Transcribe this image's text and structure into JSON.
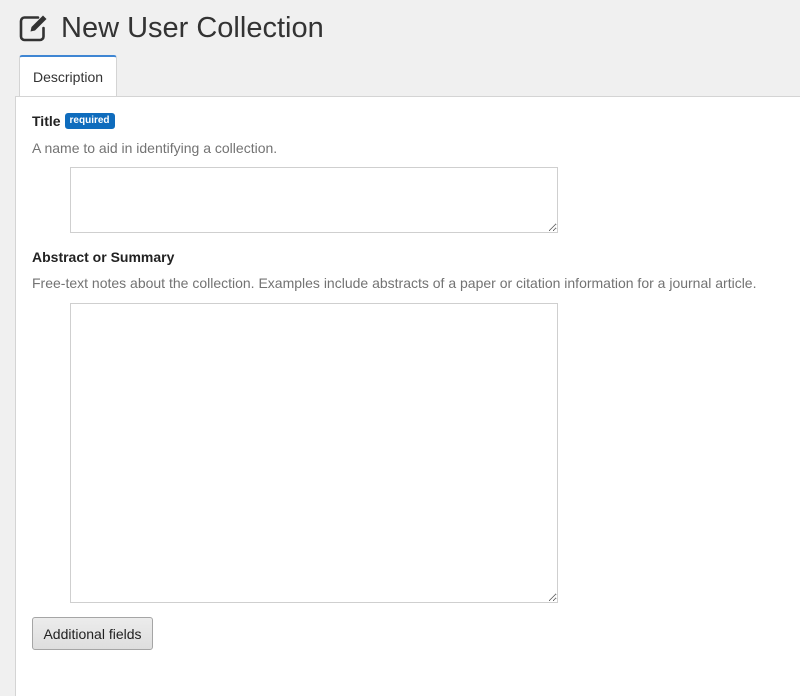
{
  "header": {
    "icon": "edit-icon",
    "title": "New User Collection"
  },
  "tabs": [
    {
      "label": "Description",
      "active": true
    }
  ],
  "form": {
    "title_field": {
      "label": "Title",
      "badge": "required",
      "help": "A name to aid in identifying a collection.",
      "value": ""
    },
    "abstract_field": {
      "label": "Abstract or Summary",
      "help": "Free-text notes about the collection. Examples include abstracts of a paper or citation information for a journal article.",
      "value": ""
    },
    "additional_fields_label": "Additional fields"
  },
  "colors": {
    "badge": "#0f6cbd",
    "tab_accent": "#3f86d3"
  }
}
